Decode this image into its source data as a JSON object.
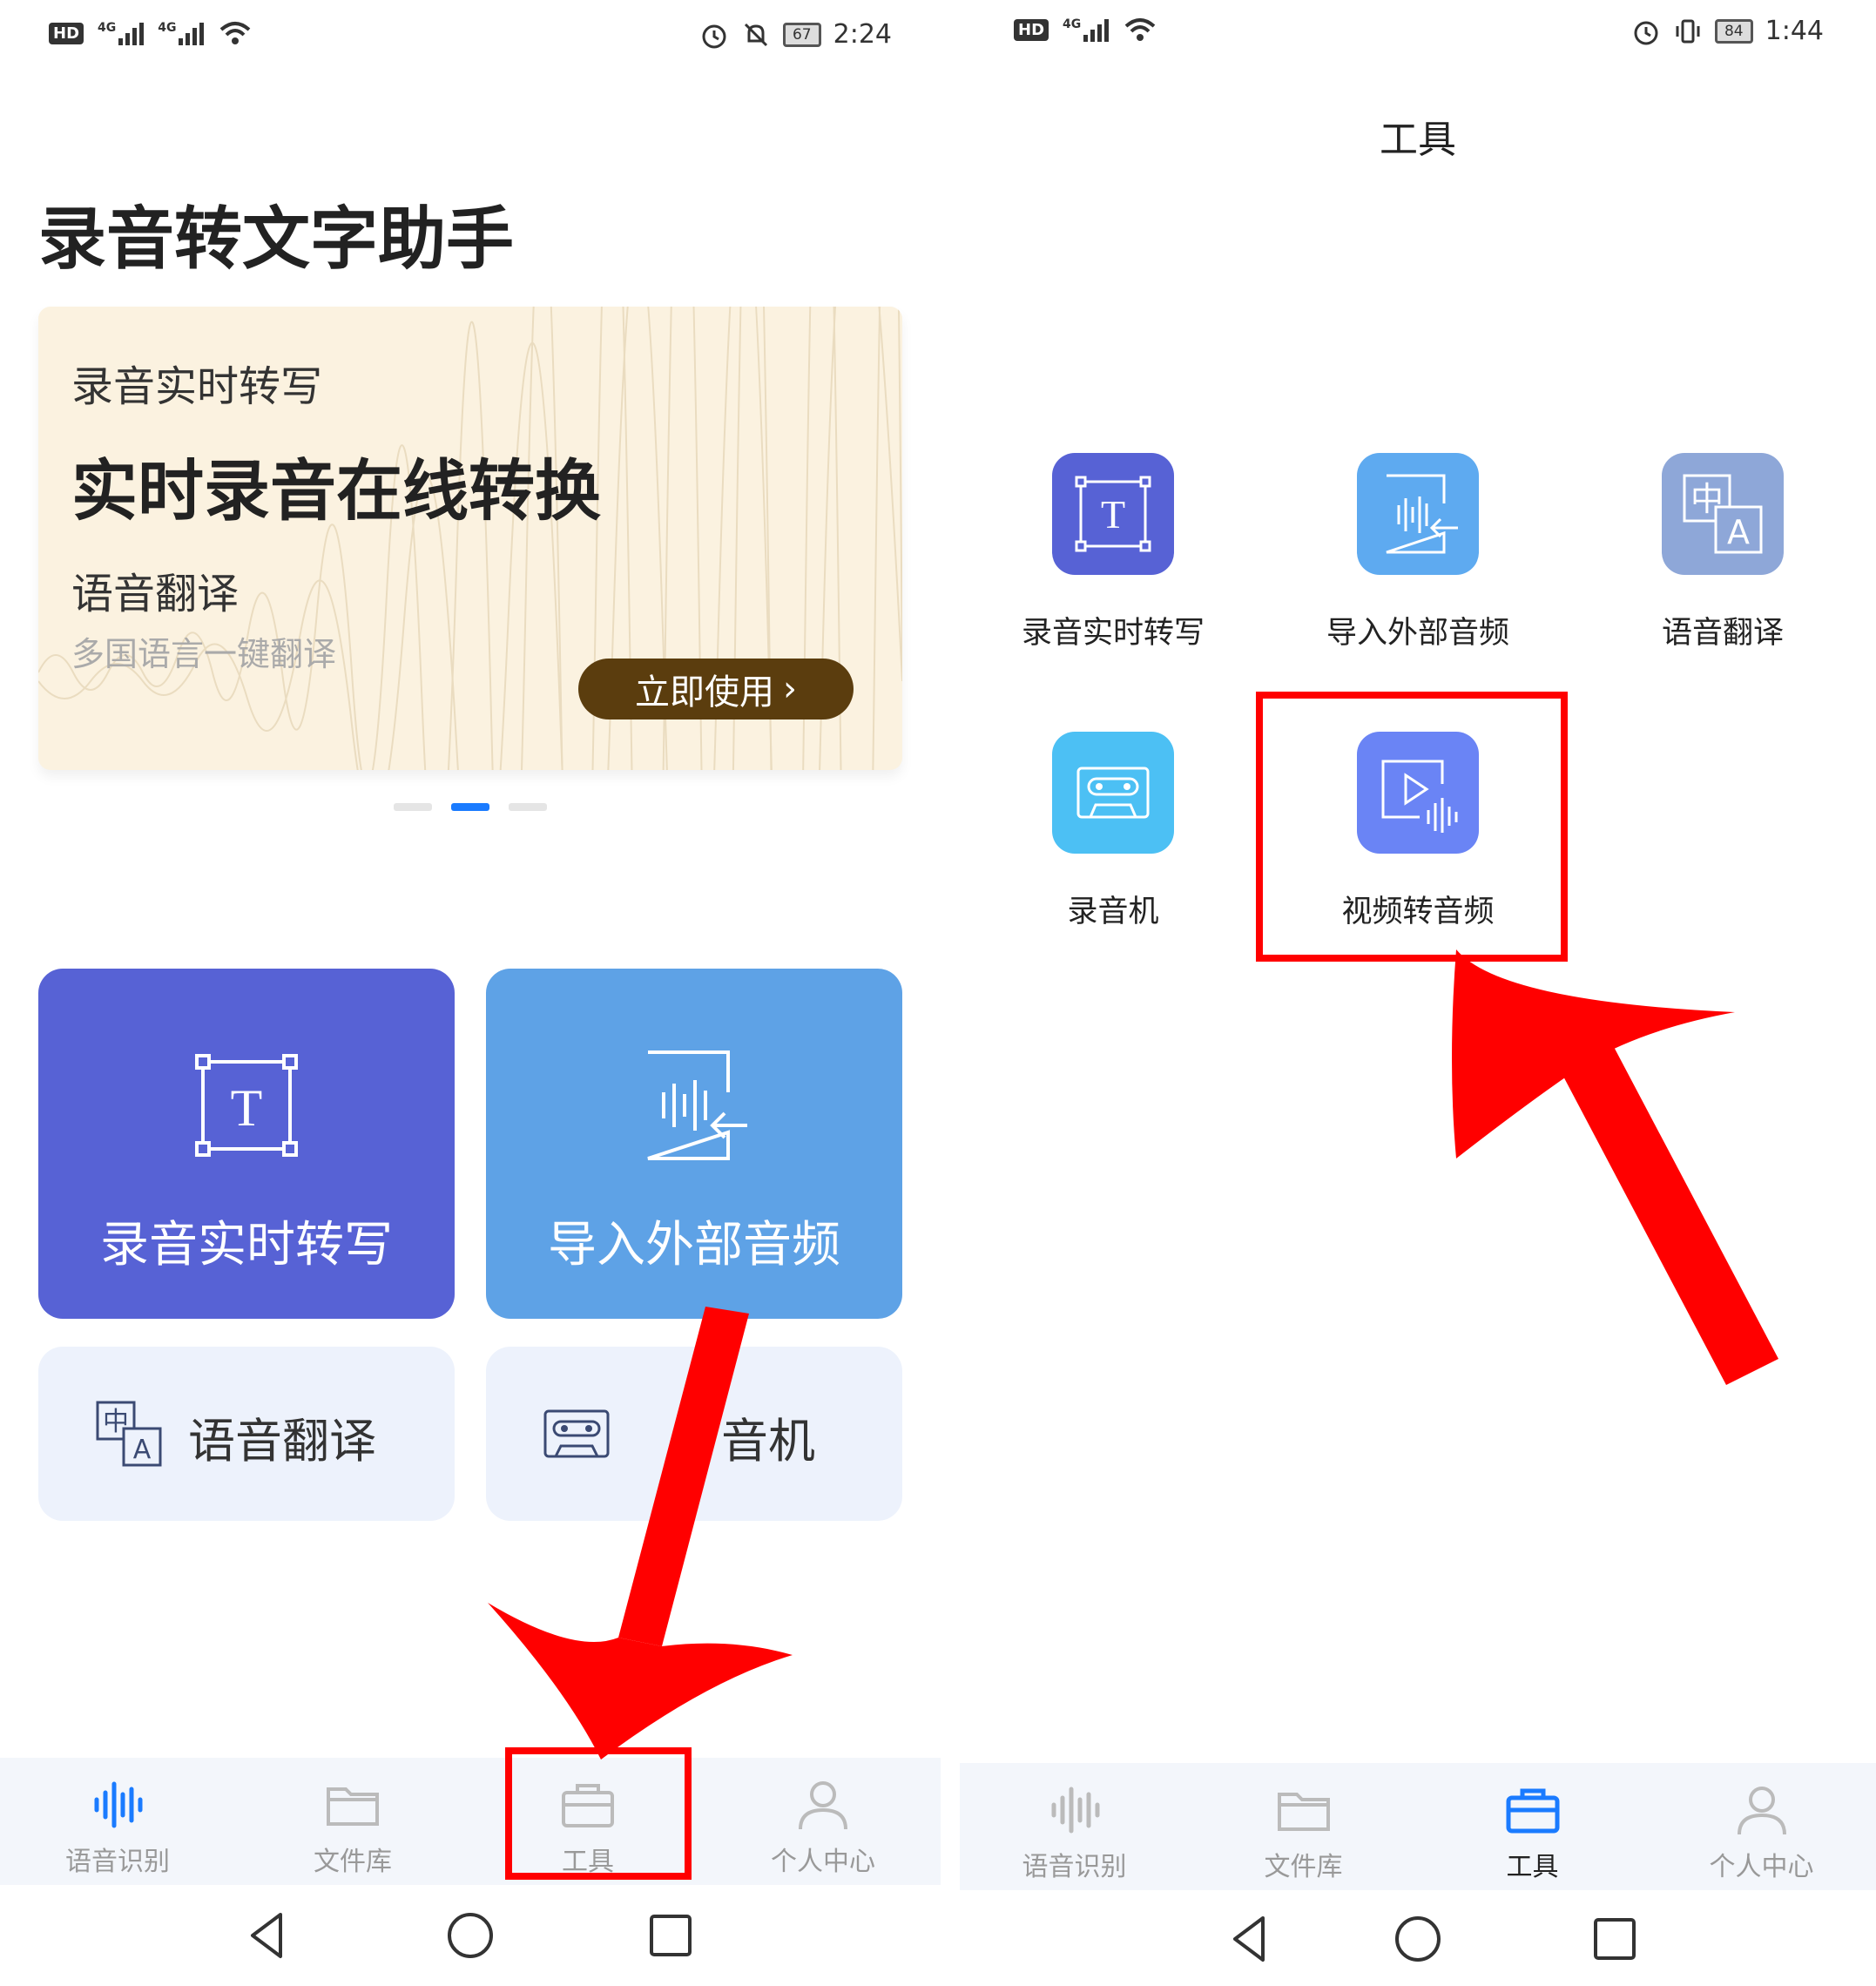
{
  "left_screen": {
    "status_bar": {
      "left_badges": [
        "HD",
        "4G",
        "4G"
      ],
      "battery": "67",
      "time": "2:24"
    },
    "app_title": "录音转文字助手",
    "banner": {
      "subtitle": "录音实时转写",
      "headline": "实时录音在线转换",
      "feature_label": "语音翻译",
      "feature_desc": "多国语言一键翻译",
      "button_label": "立即使用",
      "button_color": "#5b3d0e",
      "background": "#fbf2e0"
    },
    "carousel_dots": {
      "count": 3,
      "active_index": 1,
      "active_color": "#1a7bff"
    },
    "feature_cards": [
      {
        "label": "录音实时转写",
        "icon": "text-frame-icon",
        "color": "#5762d5"
      },
      {
        "label": "导入外部音频",
        "icon": "audio-import-icon",
        "color": "#5ea2e6"
      }
    ],
    "small_cards": [
      {
        "label": "语音翻译",
        "icon": "translate-icon"
      },
      {
        "label": "音机",
        "icon": "cassette-icon"
      }
    ],
    "tabbar": {
      "tabs": [
        {
          "label": "语音识别",
          "icon": "waveform-icon"
        },
        {
          "label": "文件库",
          "icon": "folder-icon"
        },
        {
          "label": "工具",
          "icon": "toolbox-icon"
        },
        {
          "label": "个人中心",
          "icon": "person-icon"
        }
      ],
      "active_index": -1
    }
  },
  "right_screen": {
    "status_bar": {
      "left_badges": [
        "HD",
        "4G"
      ],
      "battery": "84",
      "time": "1:44"
    },
    "page_title": "工具",
    "tools": [
      {
        "label": "录音实时转写",
        "icon": "text-frame-icon",
        "color": "#5762d5"
      },
      {
        "label": "导入外部音频",
        "icon": "audio-import-icon",
        "color": "#5eaaf0"
      },
      {
        "label": "语音翻译",
        "icon": "translate-icon",
        "color": "#8ea7d8"
      },
      {
        "label": "录音机",
        "icon": "cassette-icon",
        "color": "#4cc0f4"
      },
      {
        "label": "视频转音频",
        "icon": "video-to-audio-icon",
        "color": "#6a84f5"
      }
    ],
    "tabbar": {
      "tabs": [
        {
          "label": "语音识别",
          "icon": "waveform-icon"
        },
        {
          "label": "文件库",
          "icon": "folder-icon"
        },
        {
          "label": "工具",
          "icon": "toolbox-icon"
        },
        {
          "label": "个人中心",
          "icon": "person-icon"
        }
      ],
      "active_index": 2,
      "active_color": "#1a7bff"
    }
  },
  "annotations": {
    "highlight_color": "#ff0000"
  }
}
